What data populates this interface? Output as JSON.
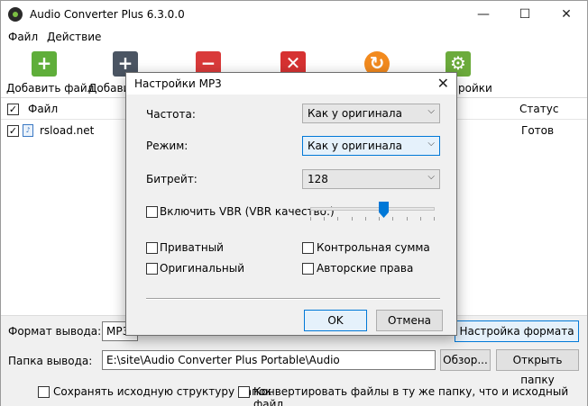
{
  "window": {
    "title": "Audio Converter Plus 6.3.0.0",
    "minimize": "—",
    "maximize": "☐",
    "close": "✕"
  },
  "menu": [
    "Файл",
    "Действие"
  ],
  "toolbar": [
    {
      "label": "Добавить файл",
      "icon": "add-file-icon",
      "glyph": "+",
      "color": "#5fae3a"
    },
    {
      "label": "Добавить",
      "icon": "add-folder-icon",
      "glyph": "+",
      "color": "#4b5563"
    },
    {
      "label": "",
      "icon": "remove-icon",
      "glyph": "−",
      "color": "#d93a3a"
    },
    {
      "label": "",
      "icon": "clear-icon",
      "glyph": "✕",
      "color": "#d63232"
    },
    {
      "label": "",
      "icon": "convert-icon",
      "glyph": "↻",
      "color": "#f28a1e"
    },
    {
      "label": "ройки",
      "icon": "settings-icon",
      "glyph": "⚙",
      "color": "#6cab3c"
    }
  ],
  "list": {
    "col_file": "Файл",
    "col_status": "Статус",
    "rows": [
      {
        "name": "rsload.net",
        "status": "Готов"
      }
    ]
  },
  "bottom": {
    "format_label": "Формат вывода:",
    "format_value": "MP3",
    "format_settings_button": "Настройка формата",
    "folder_label": "Папка вывода:",
    "folder_value": "E:\\site\\Audio Converter Plus Portable\\Audio",
    "browse_button": "Обзор...",
    "open_folder_button": "Открыть папку",
    "keep_structure": "Сохранять исходную структуру папок",
    "same_folder": "Конвертировать файлы в ту же папку, что и исходный файл"
  },
  "dialog": {
    "title": "Настройки MP3",
    "frequency_label": "Частота:",
    "frequency_value": "Как у оригинала",
    "mode_label": "Режим:",
    "mode_value": "Как у оригинала",
    "bitrate_label": "Битрейт:",
    "bitrate_value": "128",
    "vbr_label": "Включить VBR (VBR качество:)",
    "vbr_level": 0.6,
    "private_label": "Приватный",
    "checksum_label": "Контрольная сумма",
    "original_label": "Оригинальный",
    "copyright_label": "Авторские права",
    "ok_button": "OK",
    "cancel_button": "Отмена"
  },
  "colors": {
    "accent": "#0078d7"
  }
}
